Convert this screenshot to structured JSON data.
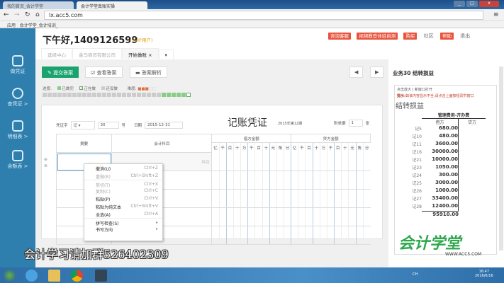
{
  "browser": {
    "tabs": [
      "我的首页_会计学堂",
      "会计学堂真账实操"
    ],
    "url": "lx.acc5.com",
    "bookmarks": [
      "应用",
      "会计学堂_会计培训_"
    ]
  },
  "sidebar": {
    "items": [
      "做凭证",
      "查凭证 >",
      "明细表 >",
      "余额表 >"
    ]
  },
  "header": {
    "greeting": "下午好,1409126599",
    "vip": "(SVIP用户)",
    "links": [
      "咨询客服",
      "视频教登体验自测",
      "购买",
      "社区",
      "帮助",
      "退出"
    ]
  },
  "tabs": [
    {
      "label": "选择中心"
    },
    {
      "label": "金马商贸有限公司"
    },
    {
      "label": "开始做账"
    }
  ],
  "toolbar": {
    "submit": "提交答案",
    "view": "查看答案",
    "analysis": "答案解析",
    "prev": "◀",
    "next": "▶"
  },
  "progress": {
    "label": "进度:",
    "done": "已做完",
    "doing": "正在做",
    "undone": "还没做",
    "difficulty_label": "难度:",
    "difficulty": "3/5"
  },
  "voucher": {
    "type_label": "凭证字",
    "type": "记",
    "number": "30",
    "number_label": "号",
    "date_label": "日期",
    "date": "2015-12-31",
    "title": "记账凭证",
    "period": "2015年第12期",
    "attach_label": "附单据",
    "attach": "1",
    "attach_unit": "张",
    "col_summary": "摘要",
    "col_account": "会计科目",
    "col_debit": "借方金额",
    "col_credit": "贷方金额",
    "digits": [
      "亿",
      "千",
      "百",
      "十",
      "万",
      "千",
      "百",
      "十",
      "元",
      "角",
      "分"
    ],
    "account_placeholder": "科目"
  },
  "context_menu": [
    {
      "label": "撤消(U)",
      "shortcut": "Ctrl+Z"
    },
    {
      "label": "重做(R)",
      "shortcut": "Ctrl+Shift+Z",
      "disabled": true
    },
    {
      "label": "剪切(T)",
      "shortcut": "Ctrl+X",
      "disabled": true
    },
    {
      "label": "复制(C)",
      "shortcut": "Ctrl+C",
      "disabled": true
    },
    {
      "label": "粘贴(P)",
      "shortcut": "Ctrl+V"
    },
    {
      "label": "粘贴为纯文本",
      "shortcut": "Ctrl+Shift+V"
    },
    {
      "label": "全选(A)",
      "shortcut": "Ctrl+A"
    },
    {
      "label": "拼写检查(S)",
      "shortcut": "▸"
    },
    {
      "label": "书写方向",
      "shortcut": "▸"
    }
  ],
  "right": {
    "title": "业务30 结转损益",
    "zoom": "点击放大",
    "newwin": "新窗口打开",
    "tip_bold": "提示:",
    "tip": "如该内容显示不全,请点击上面按钮调节窗口",
    "heading": "结转损益",
    "account": "管理费用-开办费",
    "debit": "借方",
    "credit": "贷方",
    "rows": [
      [
        "记5",
        "680.00"
      ],
      [
        "记10",
        "480.00"
      ],
      [
        "记11",
        "3600.00"
      ],
      [
        "记16",
        "30000.00"
      ],
      [
        "记21",
        "10000.00"
      ],
      [
        "记23",
        "1050.00"
      ],
      [
        "记24",
        "300.00"
      ],
      [
        "记25",
        "3000.00"
      ],
      [
        "记26",
        "1000.00"
      ],
      [
        "记27",
        "33400.00"
      ],
      [
        "记28",
        "12400.00"
      ]
    ],
    "total": "95910.00"
  },
  "watermark": {
    "text": "会计学习请加群526402309",
    "logo": "会计学堂",
    "site": "WWW.ACC5.COM"
  },
  "taskbar": {
    "time": "16:47",
    "date": "2016/6/16",
    "lang": "CH"
  },
  "colors": {
    "sidebar": "#2f7fae",
    "accent_green": "#1aa36f",
    "red": "#e8533c"
  }
}
